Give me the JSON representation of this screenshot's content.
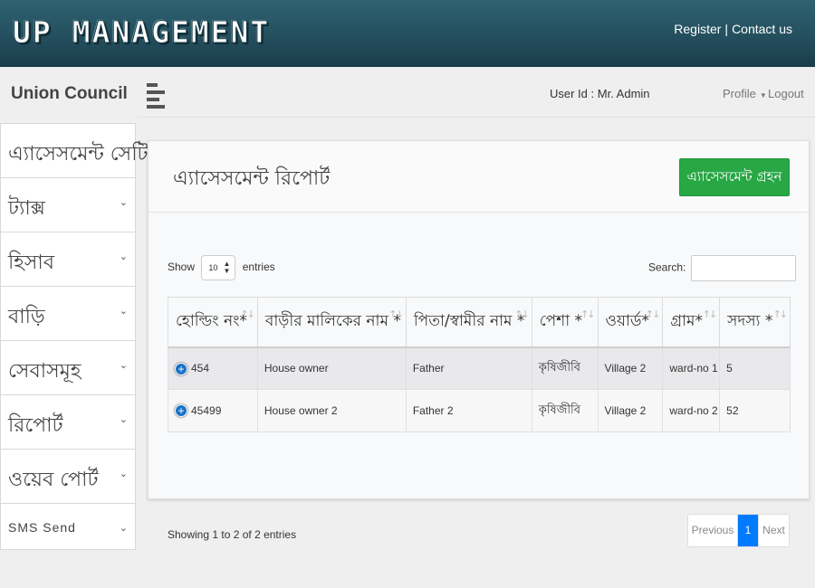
{
  "header": {
    "logo": "UP MANAGEMENT",
    "register": "Register",
    "separator": "|",
    "contact": "Contact us"
  },
  "sidebar": {
    "brand": "Union Council",
    "items": [
      {
        "label": "এ্যাসেসমেন্ট সেটিং"
      },
      {
        "label": "ট্যাক্স"
      },
      {
        "label": "হিসাব"
      },
      {
        "label": "বাড়ি"
      },
      {
        "label": "সেবাসমূহ"
      },
      {
        "label": "রিপোর্ট"
      },
      {
        "label": "ওয়েব পোর্ট"
      },
      {
        "label": "SMS Send"
      }
    ]
  },
  "userbar": {
    "user_id": "User Id : Mr. Admin",
    "profile": "Profile",
    "logout": "Logout"
  },
  "panel": {
    "title": "এ্যাসেসমেন্ট রিপোর্ট",
    "add_button": "এ্যাসেসমেন্ট গ্রহন"
  },
  "table_controls": {
    "show_label": "Show",
    "entries_value": "10",
    "entries_label": "entries",
    "search_label": "Search:",
    "search_value": ""
  },
  "table": {
    "columns": [
      "হোল্ডিং নং*",
      "বাড়ীর মালিকের নাম *",
      "পিতা/স্বামীর নাম *",
      "পেশা *",
      "ওয়ার্ড*",
      "গ্রাম*",
      "সদস্য *"
    ],
    "rows": [
      [
        "454",
        "House owner",
        "Father",
        "কৃষিজীবি",
        "Village 2",
        "ward-no 1",
        "5"
      ],
      [
        "45499",
        "House owner 2",
        "Father 2",
        "কৃষিজীবি",
        "Village 2",
        "ward-no 2",
        "52"
      ]
    ]
  },
  "footer": {
    "info": "Showing 1 to 2 of 2 entries",
    "previous": "Previous",
    "page": "1",
    "next": "Next"
  },
  "colors": {
    "header_bg": "#244f5e",
    "primary_button": "#28a745",
    "pagination_active": "#007bff",
    "expand_icon": "#1a73c9"
  }
}
